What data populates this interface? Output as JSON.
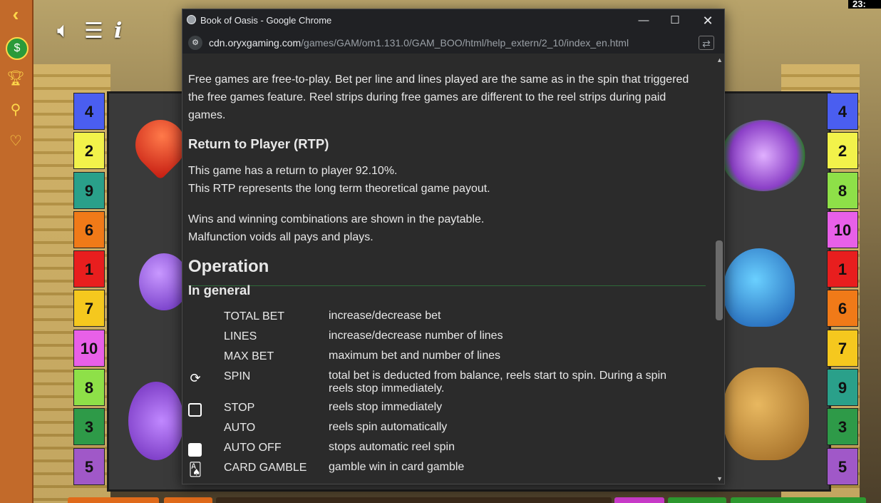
{
  "window": {
    "title": "Book of Oasis - Google Chrome",
    "minimize": "—",
    "maximize": "☐",
    "close": "✕"
  },
  "address": {
    "host": "cdn.oryxgaming.com",
    "path": "/games/GAM/om1.131.0/GAM_BOO/html/help_extern/2_10/index_en.html"
  },
  "doc": {
    "free_games_p": "Free games are free-to-play. Bet per line and lines played are the same as in the spin that triggered the free games feature. Reel strips during free games are different to the reel strips during paid games.",
    "rtp_heading": "Return to Player (RTP)",
    "rtp_line1": "This game has a return to player 92.10%.",
    "rtp_line2": "This RTP represents the long term theoretical game payout.",
    "wins_line1": "Wins and winning combinations are shown in the paytable.",
    "wins_line2": "Malfunction voids all pays and plays.",
    "operation_heading": "Operation",
    "in_general_heading": "In general",
    "operations": [
      {
        "name": "TOTAL BET",
        "desc": "increase/decrease bet",
        "icon": ""
      },
      {
        "name": "LINES",
        "desc": "increase/decrease number of lines",
        "icon": ""
      },
      {
        "name": "MAX BET",
        "desc": "maximum bet and number of lines",
        "icon": ""
      },
      {
        "name": "SPIN",
        "desc": "total bet is deducted from balance, reels start to spin. During a spin reels stop immediately.",
        "icon": "spin-icon"
      },
      {
        "name": "STOP",
        "desc": "reels stop immediately",
        "icon": "stop-icon"
      },
      {
        "name": "AUTO",
        "desc": "reels spin automatically",
        "icon": ""
      },
      {
        "name": "AUTO OFF",
        "desc": "stops automatic reel spin",
        "icon": "auto-off-icon"
      },
      {
        "name": "CARD GAMBLE",
        "desc": "gamble win in card gamble",
        "icon": "card-gamble-icon"
      }
    ]
  },
  "game": {
    "clock": "23:",
    "info_label": "i",
    "left_lines": [
      {
        "n": "4",
        "color": "#4a5ef0"
      },
      {
        "n": "2",
        "color": "#f2f24a"
      },
      {
        "n": "9",
        "color": "#2aa08a"
      },
      {
        "n": "6",
        "color": "#f07a18"
      },
      {
        "n": "1",
        "color": "#e81e1e"
      },
      {
        "n": "7",
        "color": "#f5c81e"
      },
      {
        "n": "10",
        "color": "#e860e8"
      },
      {
        "n": "8",
        "color": "#8ee048"
      },
      {
        "n": "3",
        "color": "#2e9a48"
      },
      {
        "n": "5",
        "color": "#a058c8"
      }
    ],
    "right_lines": [
      {
        "n": "4",
        "color": "#4a5ef0"
      },
      {
        "n": "2",
        "color": "#f2f24a"
      },
      {
        "n": "8",
        "color": "#8ee048"
      },
      {
        "n": "10",
        "color": "#e860e8"
      },
      {
        "n": "1",
        "color": "#e81e1e"
      },
      {
        "n": "6",
        "color": "#f07a18"
      },
      {
        "n": "7",
        "color": "#f5c81e"
      },
      {
        "n": "9",
        "color": "#2aa08a"
      },
      {
        "n": "3",
        "color": "#2e9a48"
      },
      {
        "n": "5",
        "color": "#a058c8"
      }
    ]
  }
}
